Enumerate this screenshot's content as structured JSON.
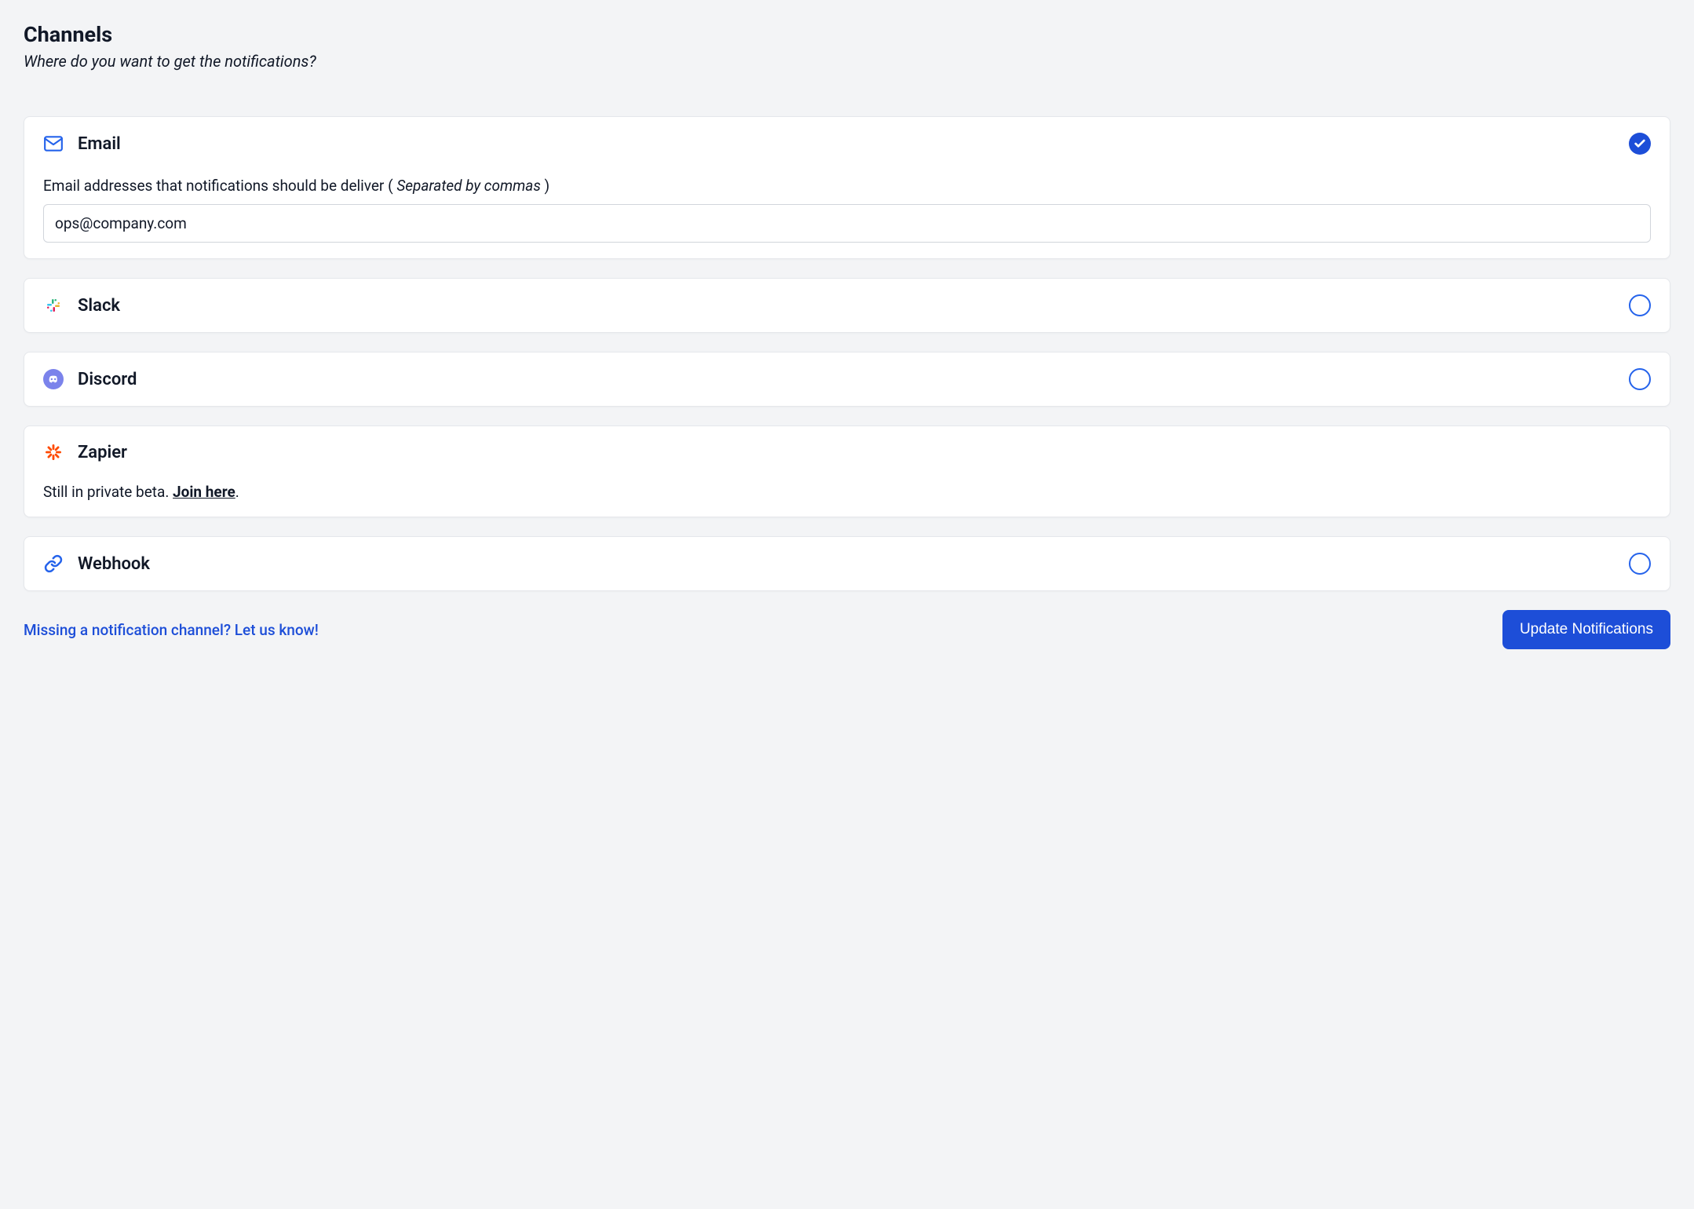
{
  "header": {
    "title": "Channels",
    "subtitle": "Where do you want to get the notifications?"
  },
  "channels": {
    "email": {
      "title": "Email",
      "label_prefix": "Email addresses that notifications should be deliver ( ",
      "label_hint": "Separated by commas",
      "label_suffix": " )",
      "value": "ops@company.com",
      "active": true
    },
    "slack": {
      "title": "Slack",
      "active": false
    },
    "discord": {
      "title": "Discord",
      "active": false
    },
    "zapier": {
      "title": "Zapier",
      "beta_prefix": "Still in private beta. ",
      "beta_link": "Join here",
      "beta_suffix": "."
    },
    "webhook": {
      "title": "Webhook",
      "active": false
    }
  },
  "footer": {
    "missing_link": "Missing a notification channel? Let us know!",
    "update_button": "Update Notifications"
  }
}
